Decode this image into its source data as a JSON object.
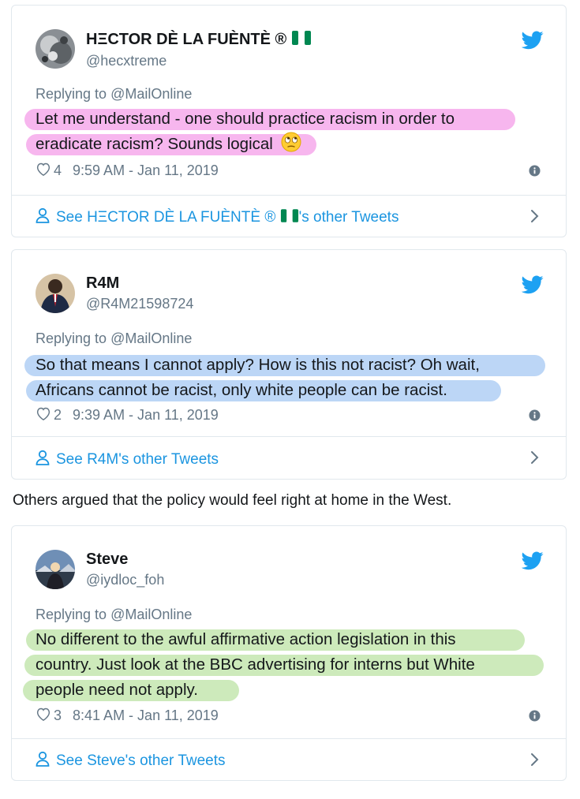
{
  "tweets": [
    {
      "name": "HΞCTOR DÈ LA FUÈNTÈ ®",
      "handle": "@hecxtreme",
      "replying_prefix": "Replying to ",
      "replying_to": "@MailOnline",
      "body_lines": [
        "Let me understand - one should practice racism in order to",
        "eradicate racism?  Sounds logical"
      ],
      "likes": "4",
      "time": "9:59 AM - Jan 11, 2019",
      "see_more_prefix": "See HΞCTOR DÈ LA FUÈNTÈ ® ",
      "see_more_suffix": "'s other Tweets",
      "highlight_color": "#f7b6ee",
      "has_flag": true,
      "has_emoji": true
    },
    {
      "name": "R4M",
      "handle": "@R4M21598724",
      "replying_prefix": "Replying to ",
      "replying_to": "@MailOnline",
      "body_lines": [
        "So that means I cannot apply? How is this not racist? Oh wait,",
        "Africans cannot be racist, only white people can be racist."
      ],
      "likes": "2",
      "time": "9:39 AM - Jan 11, 2019",
      "see_more": "See R4M's other Tweets",
      "highlight_color": "#bcd6f6"
    },
    {
      "name": "Steve",
      "handle": "@iydloc_foh",
      "replying_prefix": "Replying to ",
      "replying_to": "@MailOnline",
      "body_lines": [
        "No different to the awful affirmative action legislation in this",
        "country. Just look at the BBC advertising for interns but White",
        "people need not apply."
      ],
      "likes": "3",
      "time": "8:41 AM - Jan 11, 2019",
      "see_more": "See Steve's other Tweets",
      "highlight_color": "#cdeabb"
    }
  ],
  "interstitial_text": "Others argued that the policy would feel right at home in the West.",
  "icons": {
    "brand": "twitter-bird-icon",
    "like": "heart-outline-icon",
    "info": "info-icon",
    "profile": "person-icon",
    "chevron": "chevron-right-icon"
  },
  "colors": {
    "twitter_blue": "#1da1f2",
    "link_blue": "#1b95e0",
    "secondary_text": "#657786",
    "border": "#e1e8ed",
    "flag_green": "#008751"
  }
}
